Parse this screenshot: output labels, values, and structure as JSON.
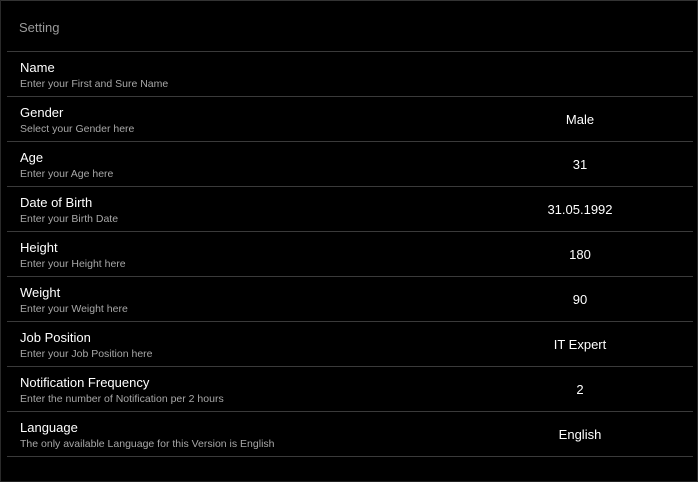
{
  "header": {
    "title": "Setting"
  },
  "settings": [
    {
      "title": "Name",
      "subtitle": "Enter your First and Sure Name",
      "value": ""
    },
    {
      "title": "Gender",
      "subtitle": "Select your Gender here",
      "value": "Male"
    },
    {
      "title": "Age",
      "subtitle": "Enter your Age here",
      "value": "31"
    },
    {
      "title": "Date of Birth",
      "subtitle": "Enter your Birth Date",
      "value": "31.05.1992"
    },
    {
      "title": "Height",
      "subtitle": "Enter your Height here",
      "value": "180"
    },
    {
      "title": "Weight",
      "subtitle": "Enter your Weight here",
      "value": "90"
    },
    {
      "title": "Job Position",
      "subtitle": "Enter your Job Position here",
      "value": "IT Expert"
    },
    {
      "title": "Notification Frequency",
      "subtitle": "Enter the number of Notification per 2 hours",
      "value": "2"
    },
    {
      "title": "Language",
      "subtitle": "The only available Language for this Version is English",
      "value": "English"
    }
  ],
  "colors": {
    "background": "#000000",
    "divider": "#3a3a3a",
    "title_text": "#ffffff",
    "subtitle_text": "#a8a8a8",
    "header_text": "#9a9a9a"
  }
}
